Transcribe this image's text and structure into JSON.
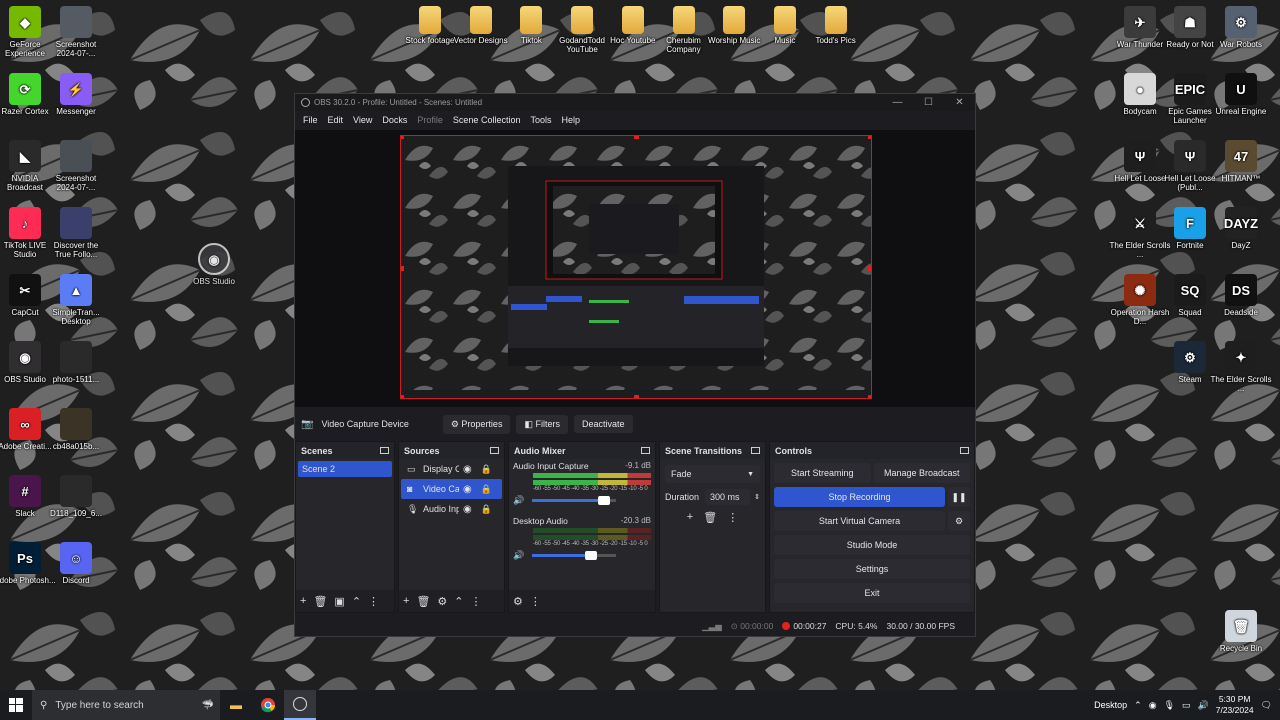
{
  "desktop": {
    "left_icons": [
      {
        "label": "GeForce Experience",
        "icon": "geforce-icon",
        "color": "#76b900",
        "glyph": "◆"
      },
      {
        "label": "Screenshot 2024-07-...",
        "icon": "screenshot-thumbnail-icon",
        "color": "#555b63",
        "glyph": ""
      },
      {
        "label": "Razer Cortex",
        "icon": "razer-cortex-icon",
        "color": "#44d62c",
        "glyph": "⟳"
      },
      {
        "label": "Messenger",
        "icon": "messenger-icon",
        "color": "#8a5cf6",
        "glyph": "⚡"
      },
      {
        "label": "NVIDIA Broadcast",
        "icon": "nvidia-broadcast-icon",
        "color": "#2a2a2a",
        "glyph": "◣"
      },
      {
        "label": "Screenshot 2024-07-...",
        "icon": "screenshot-thumbnail-icon",
        "color": "#4a4f56",
        "glyph": ""
      },
      {
        "label": "TikTok LIVE Studio",
        "icon": "tiktok-live-icon",
        "color": "#fe2c55",
        "glyph": "♪"
      },
      {
        "label": "Discover the True Follo...",
        "icon": "video-thumbnail-icon",
        "color": "#3b3f6b",
        "glyph": ""
      },
      {
        "label": "CapCut",
        "icon": "capcut-icon",
        "color": "#111111",
        "glyph": "✂"
      },
      {
        "label": "SimpleTran... Desktop",
        "icon": "simpletransfer-icon",
        "color": "#5b7cf5",
        "glyph": "▲"
      },
      {
        "label": "OBS Studio",
        "icon": "obs-studio-icon",
        "color": "#302e31",
        "glyph": "◉"
      },
      {
        "label": "photo-1511...",
        "icon": "photo-thumbnail-icon",
        "color": "#2a2a2a",
        "glyph": ""
      },
      {
        "label": "Adobe Creati...",
        "icon": "adobe-creative-cloud-icon",
        "color": "#da1f26",
        "glyph": "∞"
      },
      {
        "label": "cb48a015b...",
        "icon": "image-thumbnail-icon",
        "color": "#3a3326",
        "glyph": ""
      },
      {
        "label": "Slack",
        "icon": "slack-icon",
        "color": "#4a154b",
        "glyph": "#"
      },
      {
        "label": "D118_109_6...",
        "icon": "image-thumbnail-icon",
        "color": "#2a2a2a",
        "glyph": ""
      },
      {
        "label": "Adobe Photosh...",
        "icon": "photoshop-icon",
        "color": "#001e36",
        "glyph": "Ps"
      },
      {
        "label": "Discord",
        "icon": "discord-icon",
        "color": "#5865f2",
        "glyph": "☺"
      }
    ],
    "top_folders": [
      {
        "label": "Stock footage"
      },
      {
        "label": "Vector Designs"
      },
      {
        "label": "Tiktok"
      },
      {
        "label": "GodandTodd YouTube"
      },
      {
        "label": "Hoc Youtube"
      },
      {
        "label": "Cherubim Company"
      },
      {
        "label": "Worship Music"
      },
      {
        "label": "Music"
      },
      {
        "label": "Todd's Pics"
      }
    ],
    "floating_icon": {
      "label": "OBS Studio"
    },
    "right_icons": [
      {
        "label": "War Thunder",
        "icon": "war-thunder-icon",
        "color": "#3b3b3b",
        "glyph": "✈"
      },
      {
        "label": "Ready or Not",
        "icon": "ready-or-not-icon",
        "color": "#444",
        "glyph": "☗"
      },
      {
        "label": "War Robots",
        "icon": "war-robots-icon",
        "color": "#556070",
        "glyph": "⚙"
      },
      {
        "label": "Bodycam",
        "icon": "bodycam-icon",
        "color": "#d8d8d8",
        "glyph": "●"
      },
      {
        "label": "Epic Games Launcher",
        "icon": "epic-games-icon",
        "color": "#1c1c1c",
        "glyph": "EPIC"
      },
      {
        "label": "Unreal Engine",
        "icon": "unreal-engine-icon",
        "color": "#101010",
        "glyph": "U"
      },
      {
        "label": "Hell Let Loose",
        "icon": "hell-let-loose-icon",
        "color": "#1e1e1e",
        "glyph": "Ψ"
      },
      {
        "label": "Hell Let Loose (Publ...",
        "icon": "hell-let-loose-icon",
        "color": "#2a2a2a",
        "glyph": "Ψ"
      },
      {
        "label": "HITMAN™",
        "icon": "hitman-icon",
        "color": "#5a4a32",
        "glyph": "47"
      },
      {
        "label": "The Elder Scrolls ...",
        "icon": "elder-scrolls-icon",
        "color": "#1f1f1f",
        "glyph": "⚔"
      },
      {
        "label": "Fortnite",
        "icon": "fortnite-icon",
        "color": "#1aa0e8",
        "glyph": "F"
      },
      {
        "label": "DayZ",
        "icon": "dayz-icon",
        "color": "#222",
        "glyph": "DAYZ"
      },
      {
        "label": "Operation Harsh D...",
        "icon": "operation-harsh-doorstop-icon",
        "color": "#8a2b12",
        "glyph": "✺"
      },
      {
        "label": "Squad",
        "icon": "squad-icon",
        "color": "#1b1b1b",
        "glyph": "SQ"
      },
      {
        "label": "Deadside",
        "icon": "deadside-icon",
        "color": "#111",
        "glyph": "DS"
      },
      {
        "label": "Steam",
        "icon": "steam-icon",
        "color": "#1b2838",
        "glyph": "⚙"
      },
      {
        "label": "The Elder Scrolls ...",
        "icon": "skyrim-icon",
        "color": "#1e1e1e",
        "glyph": "✦"
      },
      {
        "label": "Recycle Bin",
        "icon": "recycle-bin-icon",
        "color": "#cfd6dd",
        "glyph": "🗑"
      }
    ]
  },
  "obs": {
    "title": "OBS 30.2.0 - Profile: Untitled - Scenes: Untitled",
    "menu": [
      "File",
      "Edit",
      "View",
      "Docks",
      "Profile",
      "Scene Collection",
      "Tools",
      "Help"
    ],
    "source_bar": {
      "source_name": "Video Capture Device",
      "properties": "Properties",
      "filters": "Filters",
      "deactivate": "Deactivate"
    },
    "scenes": {
      "title": "Scenes",
      "items": [
        "Scene 2"
      ]
    },
    "sources": {
      "title": "Sources",
      "items": [
        {
          "name": "Display C",
          "icon": "display-capture-icon",
          "selected": false
        },
        {
          "name": "Video Cap",
          "icon": "camera-icon",
          "selected": true
        },
        {
          "name": "Audio Inp",
          "icon": "microphone-icon",
          "selected": false
        }
      ]
    },
    "mixer": {
      "title": "Audio Mixer",
      "ticks": "-60 -55 -50 -45 -40 -35 -30 -25 -20 -15 -10 -5 0",
      "channels": [
        {
          "name": "Audio Input Capture",
          "db": "-9.1 dB",
          "volume": 0.85
        },
        {
          "name": "Desktop Audio",
          "db": "-20.3 dB",
          "volume": 0.7
        }
      ]
    },
    "transitions": {
      "title": "Scene Transitions",
      "selected": "Fade",
      "duration_label": "Duration",
      "duration": "300 ms"
    },
    "controls": {
      "title": "Controls",
      "start_streaming": "Start Streaming",
      "manage_broadcast": "Manage Broadcast",
      "stop_recording": "Stop Recording",
      "start_virtual_camera": "Start Virtual Camera",
      "studio_mode": "Studio Mode",
      "settings": "Settings",
      "exit": "Exit"
    },
    "status": {
      "stream_time": "00:00:00",
      "rec_time": "00:00:27",
      "cpu": "CPU: 5.4%",
      "fps": "30.00 / 30.00 FPS"
    }
  },
  "taskbar": {
    "search_placeholder": "Type here to search",
    "desktop_label": "Desktop",
    "time": "5:30 PM",
    "date": "7/23/2024"
  },
  "colors": {
    "accent": "#2f56cf",
    "record": "#e0241b",
    "selection_border": "#d01c1c"
  }
}
